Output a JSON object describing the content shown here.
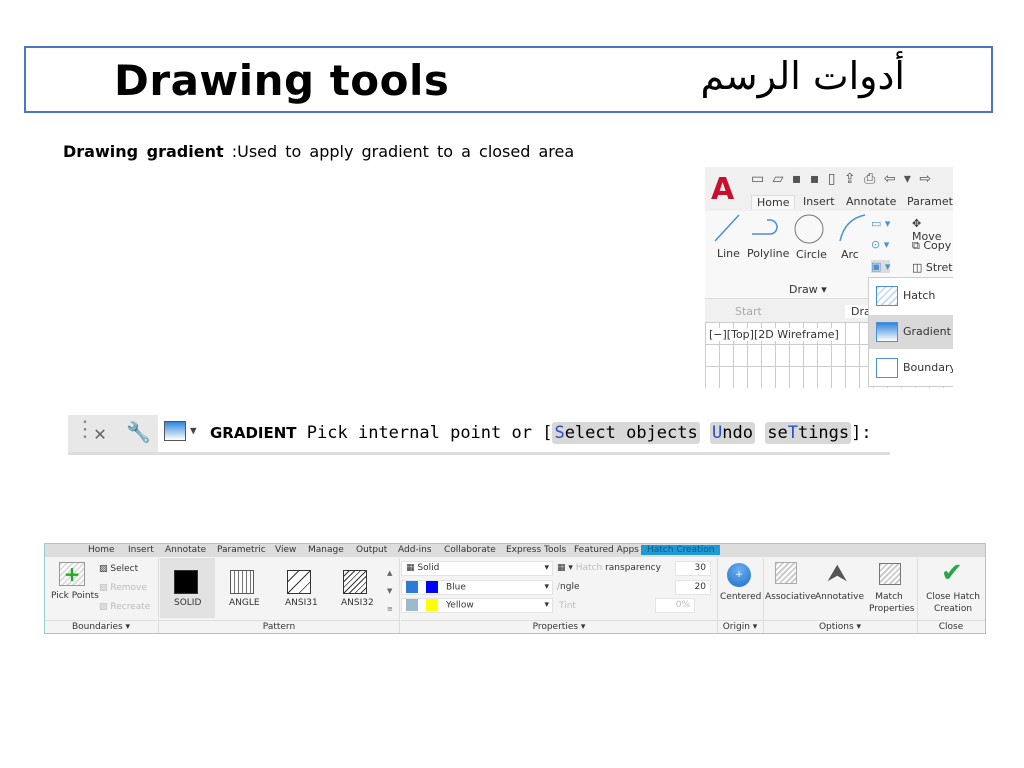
{
  "slide": {
    "title": "Drawing tools",
    "title_arabic": "أدوات الرسم",
    "subtitle_term": "Drawing  gradient",
    "subtitle_desc": " :Used  to  apply  gradient  to  a  closed  area",
    "border_color": "#4a78c0"
  },
  "autocad_home": {
    "logo": "A",
    "tabs": [
      "Home",
      "Insert",
      "Annotate",
      "Parametri"
    ],
    "tools": [
      "Line",
      "Polyline",
      "Circle",
      "Arc"
    ],
    "modify": [
      "Move",
      "Copy",
      "Stret"
    ],
    "panel_label": "Draw ▾",
    "file_tabs": [
      "Start",
      "Draw"
    ],
    "viewport_label": "[−][Top][2D Wireframe]",
    "hatch_menu": [
      "Hatch",
      "Gradient",
      "Boundary"
    ],
    "selected_menu_item": "Gradient"
  },
  "command_line": {
    "command": "GRADIENT",
    "prompt": "Pick internal point or [",
    "options": [
      {
        "hotkey_pre": "",
        "hotkey": "S",
        "rest": "elect objects"
      },
      {
        "hotkey_pre": "",
        "hotkey": "U",
        "rest": "ndo"
      },
      {
        "hotkey_pre": "se",
        "hotkey": "T",
        "rest": "tings"
      }
    ],
    "suffix": "]:"
  },
  "ribbon": {
    "tabs": [
      "Home",
      "Insert",
      "Annotate",
      "Parametric",
      "View",
      "Manage",
      "Output",
      "Add-ins",
      "Collaborate",
      "Express Tools",
      "Featured Apps",
      "Hatch Creation"
    ],
    "active_tab": "Hatch Creation",
    "boundaries": {
      "pick_points": "Pick Points",
      "select": "Select",
      "remove": "Remove",
      "recreate": "Recreate",
      "footer": "Boundaries ▾"
    },
    "patterns": [
      "SOLID",
      "ANGLE",
      "ANSI31",
      "ANSI32"
    ],
    "pattern_footer": "Pattern",
    "properties": {
      "type": "Solid",
      "color1": "Blue",
      "color2": "Yellow",
      "color1_hex": "#0000ff",
      "color2_hex": "#ffff00",
      "transparency_label": "ransparency",
      "hatch_label": "Hatch",
      "transparency": "30",
      "angle_label": "ngle",
      "angle": "20",
      "tint_label": "Tint",
      "tint": "0%",
      "footer": "Properties ▾"
    },
    "origin": {
      "centered": "Centered",
      "footer": "Origin ▾"
    },
    "options": {
      "associative": "Associative",
      "annotative": "Annotative",
      "match": "Match Properties",
      "footer": "Options ▾"
    },
    "close": {
      "label": "Close Hatch Creation",
      "footer": "Close"
    }
  }
}
